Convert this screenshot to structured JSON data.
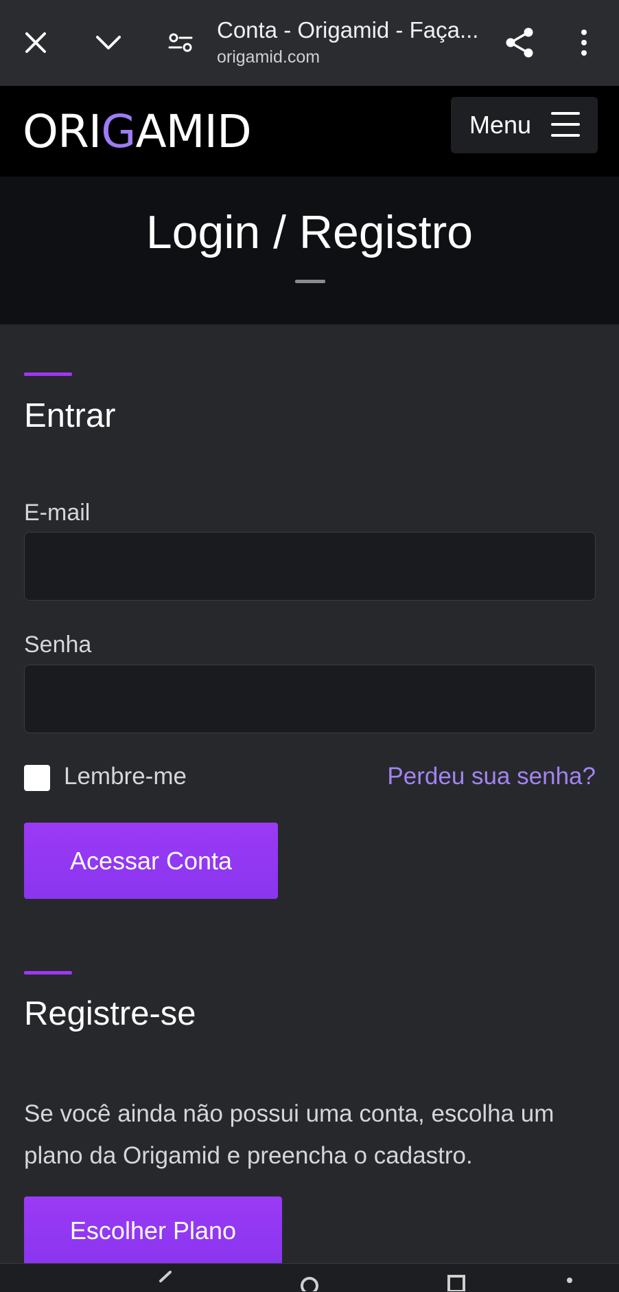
{
  "browser": {
    "tab_title": "Conta - Origamid - Faça...",
    "domain": "origamid.com",
    "icons": [
      "close-icon",
      "chevron-down-icon",
      "page-settings-icon",
      "share-icon",
      "more-vert-icon"
    ]
  },
  "header": {
    "logo_pre": "ORI",
    "logo_g": "G",
    "logo_post": "AMID",
    "menu_label": "Menu"
  },
  "hero": {
    "title": "Login / Registro"
  },
  "login": {
    "title": "Entrar",
    "email_label": "E-mail",
    "email_value": "",
    "password_label": "Senha",
    "password_value": "",
    "remember_label": "Lembre-me",
    "remember_checked": false,
    "forgot_link": "Perdeu sua senha?",
    "submit_label": "Acessar Conta"
  },
  "register": {
    "title": "Registre-se",
    "text": "Se você ainda não possui uma conta, escolha um plano da Origamid e preencha o cadastro.",
    "button_label": "Escolher Plano"
  },
  "colors": {
    "accent": "#9f36f5",
    "link": "#a384f0",
    "background": "#27282c",
    "header_bg": "#000000"
  }
}
